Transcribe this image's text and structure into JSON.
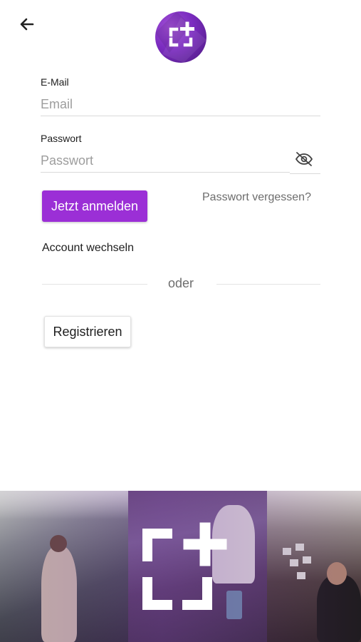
{
  "header": {
    "back_icon": "arrow-left-icon",
    "logo_icon": "brand-logo-icon"
  },
  "login_form": {
    "email": {
      "label": "E-Mail",
      "placeholder": "Email",
      "value": ""
    },
    "password": {
      "label": "Passwort",
      "placeholder": "Passwort",
      "value": "",
      "visibility_icon": "eye-off-icon"
    },
    "submit_label": "Jetzt anmelden",
    "forgot_password_label": "Passwort vergessen?",
    "switch_account_label": "Account wechseln",
    "divider_text": "oder",
    "register_label": "Registrieren"
  },
  "banner": {
    "logo_icon": "brand-logo-icon"
  },
  "colors": {
    "accent": "#9b2fd6",
    "logo_circle": "#7a2bbf",
    "text_primary": "#1d1d1d",
    "text_muted": "#6d6d6d",
    "placeholder": "#9d9d9d",
    "divider": "#e4e4e4"
  }
}
